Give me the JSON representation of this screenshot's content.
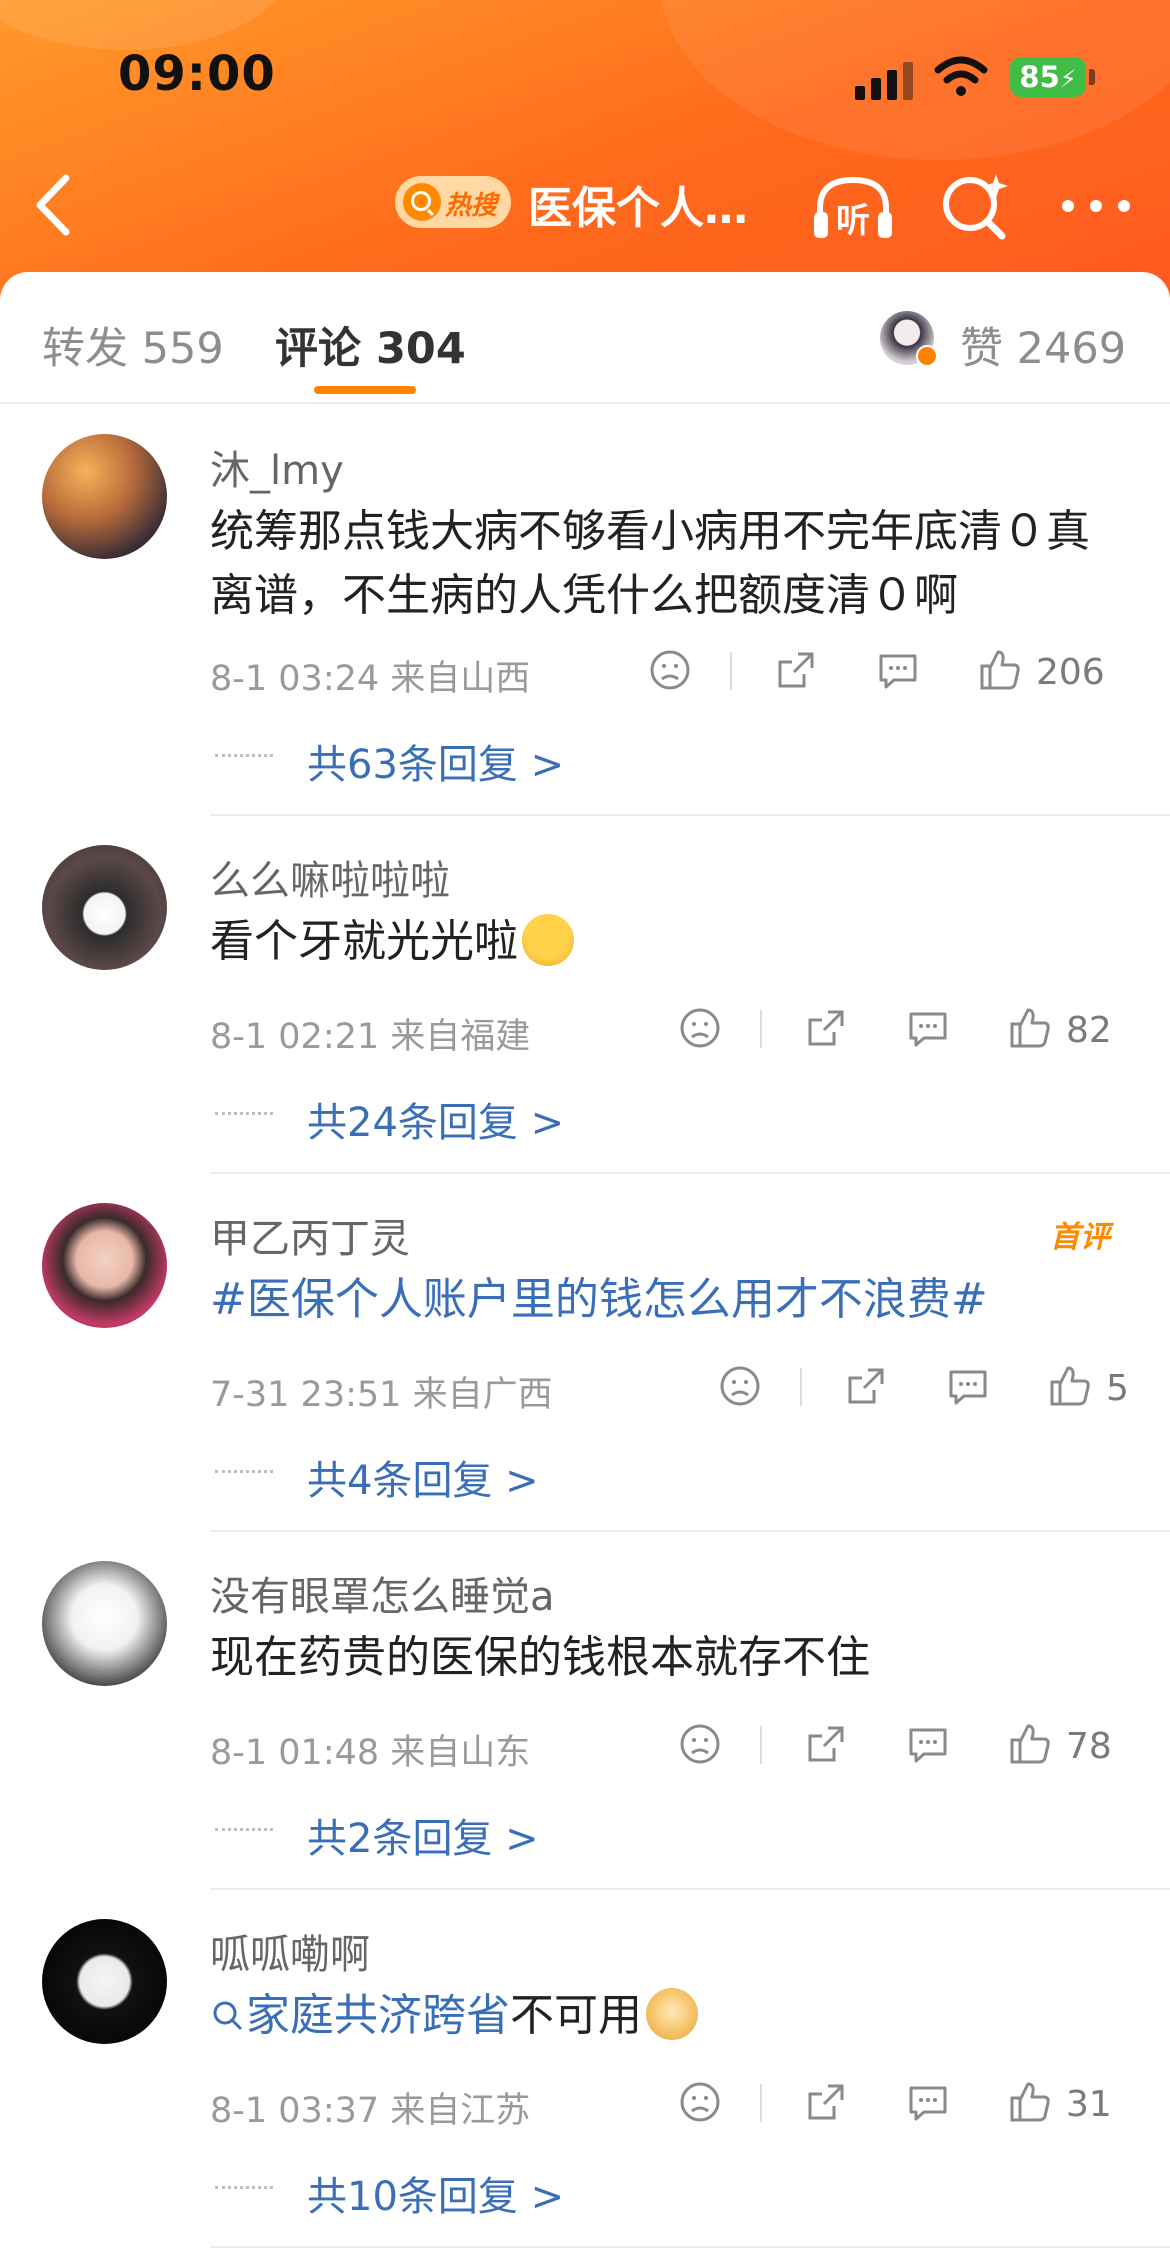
{
  "status_bar": {
    "time": "09:00",
    "battery": "85"
  },
  "header": {
    "badge": "热搜",
    "title": "医保个人…"
  },
  "tabs": {
    "repost_label": "转发",
    "repost_count": "559",
    "comment_label": "评论",
    "comment_count": "304",
    "like_label": "赞",
    "like_count": "2469"
  },
  "comments": [
    {
      "user": "沐_lmy",
      "text": "统筹那点钱大病不够看小病用不完年底清０真离谱，不生病的人凭什么把额度清０啊",
      "time": "8-1 03:24",
      "location": "来自山西",
      "likes": "206",
      "replies": "共63条回复 >"
    },
    {
      "user": "么么嘛啦啦啦",
      "text": "看个牙就光光啦",
      "emoji": "crying-face-emoji",
      "time": "8-1 02:21",
      "location": "来自福建",
      "likes": "82",
      "replies": "共24条回复 >"
    },
    {
      "user": "甲乙丙丁灵",
      "badge": "首评",
      "text": "#医保个人账户里的钱怎么用才不浪费#",
      "time": "7-31 23:51",
      "location": "来自广西",
      "likes": "5",
      "replies": "共4条回复 >"
    },
    {
      "user": "没有眼罩怎么睡觉a",
      "text": "现在药贵的医保的钱根本就存不住",
      "time": "8-1 01:48",
      "location": "来自山东",
      "likes": "78",
      "replies": "共2条回复 >"
    },
    {
      "user": "呱呱嘞啊",
      "search_link": "家庭共济跨省",
      "text": "不可用",
      "emoji": "doge-emoji",
      "time": "8-1 03:37",
      "location": "来自江苏",
      "likes": "31",
      "replies": "共10条回复 >"
    }
  ],
  "colors": {
    "accent": "#ff8200",
    "link": "#3a6fb8",
    "header": "#ff6a1c"
  }
}
